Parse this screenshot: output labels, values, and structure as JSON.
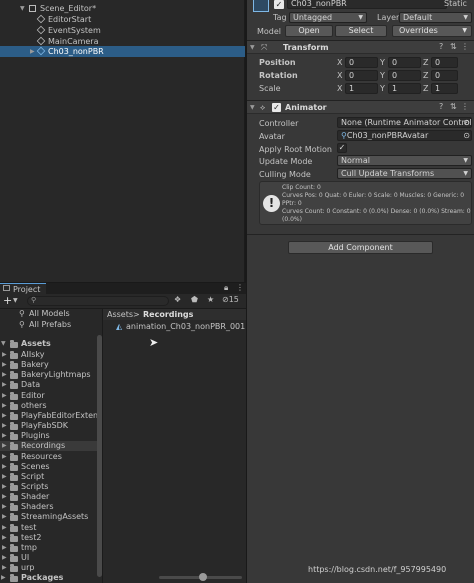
{
  "hierarchy": {
    "items": [
      {
        "label": "Scene_Editor*",
        "selected": false
      },
      {
        "label": "EditorStart",
        "selected": false
      },
      {
        "label": "EventSystem",
        "selected": false
      },
      {
        "label": "MainCamera",
        "selected": false
      },
      {
        "label": "Ch03_nonPBR",
        "selected": true
      }
    ]
  },
  "inspector": {
    "object_name": "Ch03_nonPBR",
    "static_label": "Static",
    "tag_label": "Tag",
    "tag_value": "Untagged",
    "layer_label": "Layer",
    "layer_value": "Default",
    "model_label": "Model",
    "open_button": "Open",
    "select_button": "Select",
    "overrides_button": "Overrides",
    "transform": {
      "title": "Transform",
      "rows": [
        {
          "label": "Position",
          "x": "0",
          "y": "0",
          "z": "0"
        },
        {
          "label": "Rotation",
          "x": "0",
          "y": "0",
          "z": "0"
        },
        {
          "label": "Scale",
          "x": "1",
          "y": "1",
          "z": "1"
        }
      ],
      "x_label": "X",
      "y_label": "Y",
      "z_label": "Z"
    },
    "animator": {
      "title": "Animator",
      "controller_label": "Controller",
      "controller_value": "None (Runtime Animator Controller)",
      "avatar_label": "Avatar",
      "avatar_value": "Ch03_nonPBRAvatar",
      "apply_root_motion_label": "Apply Root Motion",
      "apply_root_motion_checked": true,
      "update_mode_label": "Update Mode",
      "update_mode_value": "Normal",
      "culling_mode_label": "Culling Mode",
      "culling_mode_value": "Cull Update Transforms",
      "info_line1": "Clip Count: 0",
      "info_line2": "Curves Pos: 0 Quat: 0 Euler: 0 Scale: 0 Muscles: 0 Generic: 0 PPtr: 0",
      "info_line3": "Curves Count: 0 Constant: 0 (0.0%) Dense: 0 (0.0%) Stream: 0 (0.0%)"
    },
    "add_component": "Add Component"
  },
  "project": {
    "tab_label": "Project",
    "hidden_count": "15",
    "favorites": [
      "All Models",
      "All Prefabs"
    ],
    "assets_root": "Assets",
    "folders": [
      "AIIsky",
      "Bakery",
      "BakeryLightmaps",
      "Data",
      "Editor",
      "others",
      "PlayFabEditorExtensions",
      "PlayFabSDK",
      "Plugins",
      "Recordings",
      "Resources",
      "Scenes",
      "Script",
      "Scripts",
      "Shader",
      "Shaders",
      "StreamingAssets",
      "test",
      "test2",
      "tmp",
      "UI",
      "urp"
    ],
    "selected_folder": "Recordings",
    "packages_root": "Packages",
    "breadcrumb_root": "Assets",
    "breadcrumb_sep": ">",
    "breadcrumb_current": "Recordings",
    "file_name": "animation_Ch03_nonPBR_001"
  },
  "watermark": "https://blog.csdn.net/f_957995490",
  "colors": {
    "selection": "#2c5d87",
    "panel": "#282828",
    "inspector": "#383838"
  }
}
